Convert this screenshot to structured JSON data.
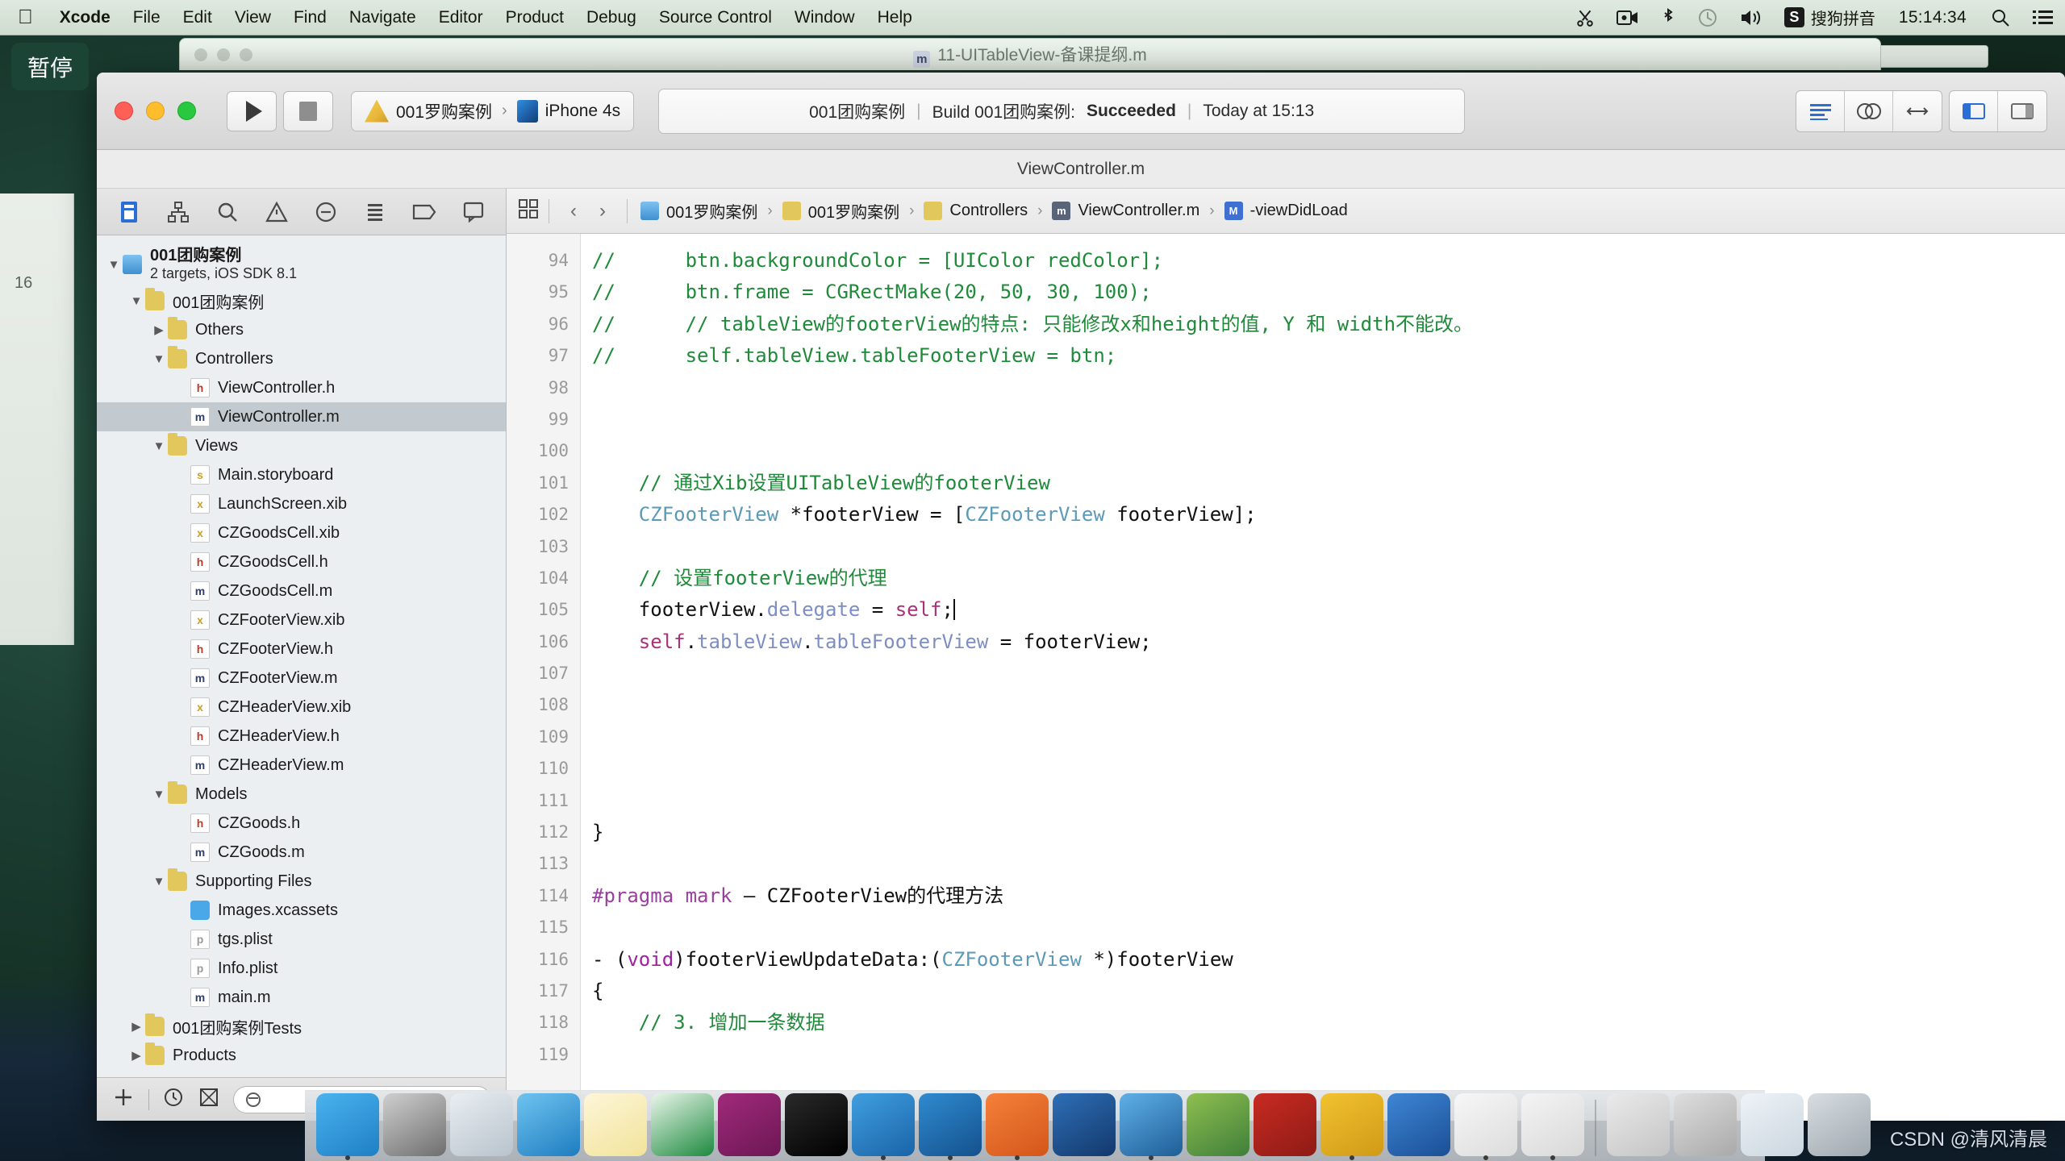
{
  "menubar": {
    "apple_icon": "apple-logo-icon",
    "items": [
      {
        "label": "Xcode",
        "bold": true
      },
      {
        "label": "File",
        "bold": false
      },
      {
        "label": "Edit",
        "bold": false
      },
      {
        "label": "View",
        "bold": false
      },
      {
        "label": "Find",
        "bold": false
      },
      {
        "label": "Navigate",
        "bold": false
      },
      {
        "label": "Editor",
        "bold": false
      },
      {
        "label": "Product",
        "bold": false
      },
      {
        "label": "Debug",
        "bold": false
      },
      {
        "label": "Source Control",
        "bold": false
      },
      {
        "label": "Window",
        "bold": false
      },
      {
        "label": "Help",
        "bold": false
      }
    ],
    "status_icons": [
      "scissors-icon",
      "screen-record-icon",
      "bluetooth-icon",
      "time-machine-icon",
      "volume-icon"
    ],
    "ime_badge": "S",
    "ime_label": "搜狗拼音",
    "clock": "15:14:34",
    "spotlight_icon": "search-icon",
    "notification_icon": "list-icon"
  },
  "overlay": {
    "pause_label": "暂停"
  },
  "background_window": {
    "title": "11-UITableView-备课提纲.m",
    "file_badge": "m"
  },
  "xcode": {
    "toolbar": {
      "run_icon": "play-icon",
      "stop_icon": "stop-icon",
      "scheme_name": "001罗购案例",
      "scheme_chevron": "›",
      "destination": "iPhone 4s",
      "activity": {
        "project": "001团购案例",
        "sep1": "|",
        "build_text": "Build 001团购案例:",
        "build_status": "Succeeded",
        "sep2": "|",
        "timestamp": "Today at 15:13"
      },
      "right_icons": [
        "standard-editor-icon",
        "assistant-editor-icon",
        "version-editor-icon",
        "hide-navigator-icon",
        "hide-utilities-icon"
      ]
    },
    "title_strip": "ViewController.m",
    "navigator": {
      "tabs": [
        "project-navigator-icon",
        "symbol-navigator-icon",
        "search-navigator-icon",
        "issue-navigator-icon",
        "test-navigator-icon",
        "debug-navigator-icon",
        "breakpoint-navigator-icon",
        "report-navigator-icon"
      ],
      "tree": [
        {
          "indent": 0,
          "twisty": "▼",
          "icon": "project",
          "label": "001团购案例",
          "sub": "2 targets, iOS SDK 8.1",
          "selected": false
        },
        {
          "indent": 1,
          "twisty": "▼",
          "icon": "folder",
          "label": "001团购案例",
          "sub": "",
          "selected": false
        },
        {
          "indent": 2,
          "twisty": "▶",
          "icon": "folder",
          "label": "Others",
          "sub": "",
          "selected": false
        },
        {
          "indent": 2,
          "twisty": "▼",
          "icon": "folder",
          "label": "Controllers",
          "sub": "",
          "selected": false
        },
        {
          "indent": 3,
          "twisty": "",
          "icon": "h",
          "label": "ViewController.h",
          "sub": "",
          "selected": false
        },
        {
          "indent": 3,
          "twisty": "",
          "icon": "m",
          "label": "ViewController.m",
          "sub": "",
          "selected": true
        },
        {
          "indent": 2,
          "twisty": "▼",
          "icon": "folder",
          "label": "Views",
          "sub": "",
          "selected": false
        },
        {
          "indent": 3,
          "twisty": "",
          "icon": "sb",
          "label": "Main.storyboard",
          "sub": "",
          "selected": false
        },
        {
          "indent": 3,
          "twisty": "",
          "icon": "xib",
          "label": "LaunchScreen.xib",
          "sub": "",
          "selected": false
        },
        {
          "indent": 3,
          "twisty": "",
          "icon": "xib",
          "label": "CZGoodsCell.xib",
          "sub": "",
          "selected": false
        },
        {
          "indent": 3,
          "twisty": "",
          "icon": "h",
          "label": "CZGoodsCell.h",
          "sub": "",
          "selected": false
        },
        {
          "indent": 3,
          "twisty": "",
          "icon": "m",
          "label": "CZGoodsCell.m",
          "sub": "",
          "selected": false
        },
        {
          "indent": 3,
          "twisty": "",
          "icon": "xib",
          "label": "CZFooterView.xib",
          "sub": "",
          "selected": false
        },
        {
          "indent": 3,
          "twisty": "",
          "icon": "h",
          "label": "CZFooterView.h",
          "sub": "",
          "selected": false
        },
        {
          "indent": 3,
          "twisty": "",
          "icon": "m",
          "label": "CZFooterView.m",
          "sub": "",
          "selected": false
        },
        {
          "indent": 3,
          "twisty": "",
          "icon": "xib",
          "label": "CZHeaderView.xib",
          "sub": "",
          "selected": false
        },
        {
          "indent": 3,
          "twisty": "",
          "icon": "h",
          "label": "CZHeaderView.h",
          "sub": "",
          "selected": false
        },
        {
          "indent": 3,
          "twisty": "",
          "icon": "m",
          "label": "CZHeaderView.m",
          "sub": "",
          "selected": false
        },
        {
          "indent": 2,
          "twisty": "▼",
          "icon": "folder",
          "label": "Models",
          "sub": "",
          "selected": false
        },
        {
          "indent": 3,
          "twisty": "",
          "icon": "h",
          "label": "CZGoods.h",
          "sub": "",
          "selected": false
        },
        {
          "indent": 3,
          "twisty": "",
          "icon": "m",
          "label": "CZGoods.m",
          "sub": "",
          "selected": false
        },
        {
          "indent": 2,
          "twisty": "▼",
          "icon": "folder",
          "label": "Supporting Files",
          "sub": "",
          "selected": false
        },
        {
          "indent": 3,
          "twisty": "",
          "icon": "assets",
          "label": "Images.xcassets",
          "sub": "",
          "selected": false
        },
        {
          "indent": 3,
          "twisty": "",
          "icon": "plist",
          "label": "tgs.plist",
          "sub": "",
          "selected": false
        },
        {
          "indent": 3,
          "twisty": "",
          "icon": "plist",
          "label": "Info.plist",
          "sub": "",
          "selected": false
        },
        {
          "indent": 3,
          "twisty": "",
          "icon": "m",
          "label": "main.m",
          "sub": "",
          "selected": false
        },
        {
          "indent": 1,
          "twisty": "▶",
          "icon": "folder",
          "label": "001团购案例Tests",
          "sub": "",
          "selected": false
        },
        {
          "indent": 1,
          "twisty": "▶",
          "icon": "folder",
          "label": "Products",
          "sub": "",
          "selected": false
        }
      ],
      "footer": {
        "add_icon": "plus-icon",
        "recent_icon": "clock-icon",
        "source_control_icon": "source-control-filter-icon",
        "filter_placeholder": "",
        "filter_value": ""
      }
    },
    "jumpbar": {
      "related_icon": "related-items-icon",
      "back_icon": "‹",
      "forward_icon": "›",
      "crumbs": [
        {
          "icon": "project",
          "label": "001罗购案例"
        },
        {
          "icon": "folder",
          "label": "001罗购案例"
        },
        {
          "icon": "folder",
          "label": "Controllers"
        },
        {
          "icon": "m",
          "label": "ViewController.m"
        },
        {
          "icon": "method",
          "label": "-viewDidLoad"
        }
      ]
    },
    "code": {
      "first_line": 94,
      "lines": [
        {
          "n": 94,
          "tokens": [
            {
              "t": "//",
              "c": "com"
            },
            {
              "t": "      btn.backgroundColor = [UIColor redColor];",
              "c": "com"
            }
          ]
        },
        {
          "n": 95,
          "tokens": [
            {
              "t": "//",
              "c": "com"
            },
            {
              "t": "      btn.frame = CGRectMake(20, 50, 30, 100);",
              "c": "com"
            }
          ]
        },
        {
          "n": 96,
          "tokens": [
            {
              "t": "//",
              "c": "com"
            },
            {
              "t": "      // tableView的footerView的特点: 只能修改x和height的值, Y 和 width不能改。",
              "c": "com"
            }
          ]
        },
        {
          "n": 97,
          "tokens": [
            {
              "t": "//",
              "c": "com"
            },
            {
              "t": "      self.tableView.tableFooterView = btn;",
              "c": "com"
            }
          ]
        },
        {
          "n": 98,
          "tokens": []
        },
        {
          "n": 99,
          "tokens": []
        },
        {
          "n": 100,
          "tokens": []
        },
        {
          "n": 101,
          "tokens": [
            {
              "t": "    // 通过Xib设置UITableView的footerView",
              "c": "com"
            }
          ]
        },
        {
          "n": 102,
          "tokens": [
            {
              "t": "    ",
              "c": "plain"
            },
            {
              "t": "CZFooterView",
              "c": "type"
            },
            {
              "t": " *footerView = [",
              "c": "plain"
            },
            {
              "t": "CZFooterView",
              "c": "type"
            },
            {
              "t": " footerView];",
              "c": "plain"
            }
          ]
        },
        {
          "n": 103,
          "tokens": []
        },
        {
          "n": 104,
          "tokens": [
            {
              "t": "    // 设置footerView的代理",
              "c": "com"
            }
          ]
        },
        {
          "n": 105,
          "tokens": [
            {
              "t": "    footerView.",
              "c": "plain"
            },
            {
              "t": "delegate",
              "c": "prop"
            },
            {
              "t": " = ",
              "c": "plain"
            },
            {
              "t": "self",
              "c": "self"
            },
            {
              "t": ";",
              "c": "plain"
            },
            {
              "t": "|",
              "c": "caret"
            }
          ]
        },
        {
          "n": 106,
          "tokens": [
            {
              "t": "    ",
              "c": "plain"
            },
            {
              "t": "self",
              "c": "self"
            },
            {
              "t": ".",
              "c": "plain"
            },
            {
              "t": "tableView",
              "c": "prop"
            },
            {
              "t": ".",
              "c": "plain"
            },
            {
              "t": "tableFooterView",
              "c": "prop"
            },
            {
              "t": " = footerView;",
              "c": "plain"
            }
          ]
        },
        {
          "n": 107,
          "tokens": []
        },
        {
          "n": 108,
          "tokens": []
        },
        {
          "n": 109,
          "tokens": []
        },
        {
          "n": 110,
          "tokens": []
        },
        {
          "n": 111,
          "tokens": []
        },
        {
          "n": 112,
          "tokens": [
            {
              "t": "}",
              "c": "plain"
            }
          ]
        },
        {
          "n": 113,
          "tokens": []
        },
        {
          "n": 114,
          "tokens": [
            {
              "t": "#pragma mark",
              "c": "pre"
            },
            {
              "t": " – CZFooterView的代理方法",
              "c": "plain"
            }
          ]
        },
        {
          "n": 115,
          "tokens": []
        },
        {
          "n": 116,
          "tokens": [
            {
              "t": "- (",
              "c": "plain"
            },
            {
              "t": "void",
              "c": "kw"
            },
            {
              "t": ")footerViewUpdateData:(",
              "c": "plain"
            },
            {
              "t": "CZFooterView",
              "c": "type"
            },
            {
              "t": " *)footerView",
              "c": "plain"
            }
          ]
        },
        {
          "n": 117,
          "tokens": [
            {
              "t": "{",
              "c": "plain"
            }
          ]
        },
        {
          "n": 118,
          "tokens": [
            {
              "t": "    // 3. 增加一条数据",
              "c": "com"
            }
          ]
        },
        {
          "n": 119,
          "tokens": []
        }
      ]
    }
  },
  "dock": {
    "items": [
      {
        "name": "finder",
        "running": true,
        "colors": [
          "#4ab3ef",
          "#1f7fc4"
        ]
      },
      {
        "name": "system-preferences",
        "running": false,
        "colors": [
          "#cfcfcf",
          "#6e6e6e"
        ]
      },
      {
        "name": "launchpad",
        "running": false,
        "colors": [
          "#e9eef2",
          "#b8c3cc"
        ]
      },
      {
        "name": "safari",
        "running": false,
        "colors": [
          "#6fc3f0",
          "#1e7dc0"
        ]
      },
      {
        "name": "notes",
        "running": false,
        "colors": [
          "#fdf6d8",
          "#f2e39a"
        ]
      },
      {
        "name": "excel",
        "running": false,
        "colors": [
          "#eaf6ea",
          "#1d8a3f"
        ]
      },
      {
        "name": "onenote",
        "running": false,
        "colors": [
          "#a02a7a",
          "#6d1755"
        ]
      },
      {
        "name": "terminal",
        "running": false,
        "colors": [
          "#2a2a2a",
          "#000000"
        ]
      },
      {
        "name": "xcode",
        "running": true,
        "colors": [
          "#3f9fe0",
          "#1b63a8"
        ]
      },
      {
        "name": "xcode-beta",
        "running": true,
        "colors": [
          "#2f8bd0",
          "#14518d"
        ]
      },
      {
        "name": "preview-question",
        "running": true,
        "colors": [
          "#f4813a",
          "#d4561a"
        ]
      },
      {
        "name": "snipaste",
        "running": false,
        "colors": [
          "#2e6fb7",
          "#13386b"
        ]
      },
      {
        "name": "quicktime",
        "running": true,
        "colors": [
          "#5fb0e8",
          "#1f5d96"
        ]
      },
      {
        "name": "photos",
        "running": false,
        "colors": [
          "#8fbf50",
          "#3f7f3a"
        ]
      },
      {
        "name": "filezilla",
        "running": false,
        "colors": [
          "#c72b22",
          "#8e1b15"
        ]
      },
      {
        "name": "sketch",
        "running": true,
        "colors": [
          "#f2c230",
          "#d09a17"
        ]
      },
      {
        "name": "word",
        "running": false,
        "colors": [
          "#3e86d4",
          "#1b4f96"
        ]
      },
      {
        "name": "app-store-a",
        "running": true,
        "colors": [
          "#f7f7f7",
          "#dcdcdc"
        ]
      },
      {
        "name": "font-book",
        "running": true,
        "colors": [
          "#f4f4f4",
          "#d8d8d8"
        ]
      },
      {
        "name": "sep",
        "running": false,
        "colors": []
      },
      {
        "name": "document-stack",
        "running": false,
        "colors": [
          "#eaeaea",
          "#c4c4c4"
        ]
      },
      {
        "name": "downloads-folder",
        "running": false,
        "colors": [
          "#dedede",
          "#a9a9a9"
        ]
      },
      {
        "name": "screenshot-file",
        "running": false,
        "colors": [
          "#eef3f7",
          "#cbd6df"
        ]
      },
      {
        "name": "trash",
        "running": false,
        "colors": [
          "#d8dde1",
          "#9ea8af"
        ]
      }
    ]
  },
  "watermark": "CSDN @清风清晨"
}
